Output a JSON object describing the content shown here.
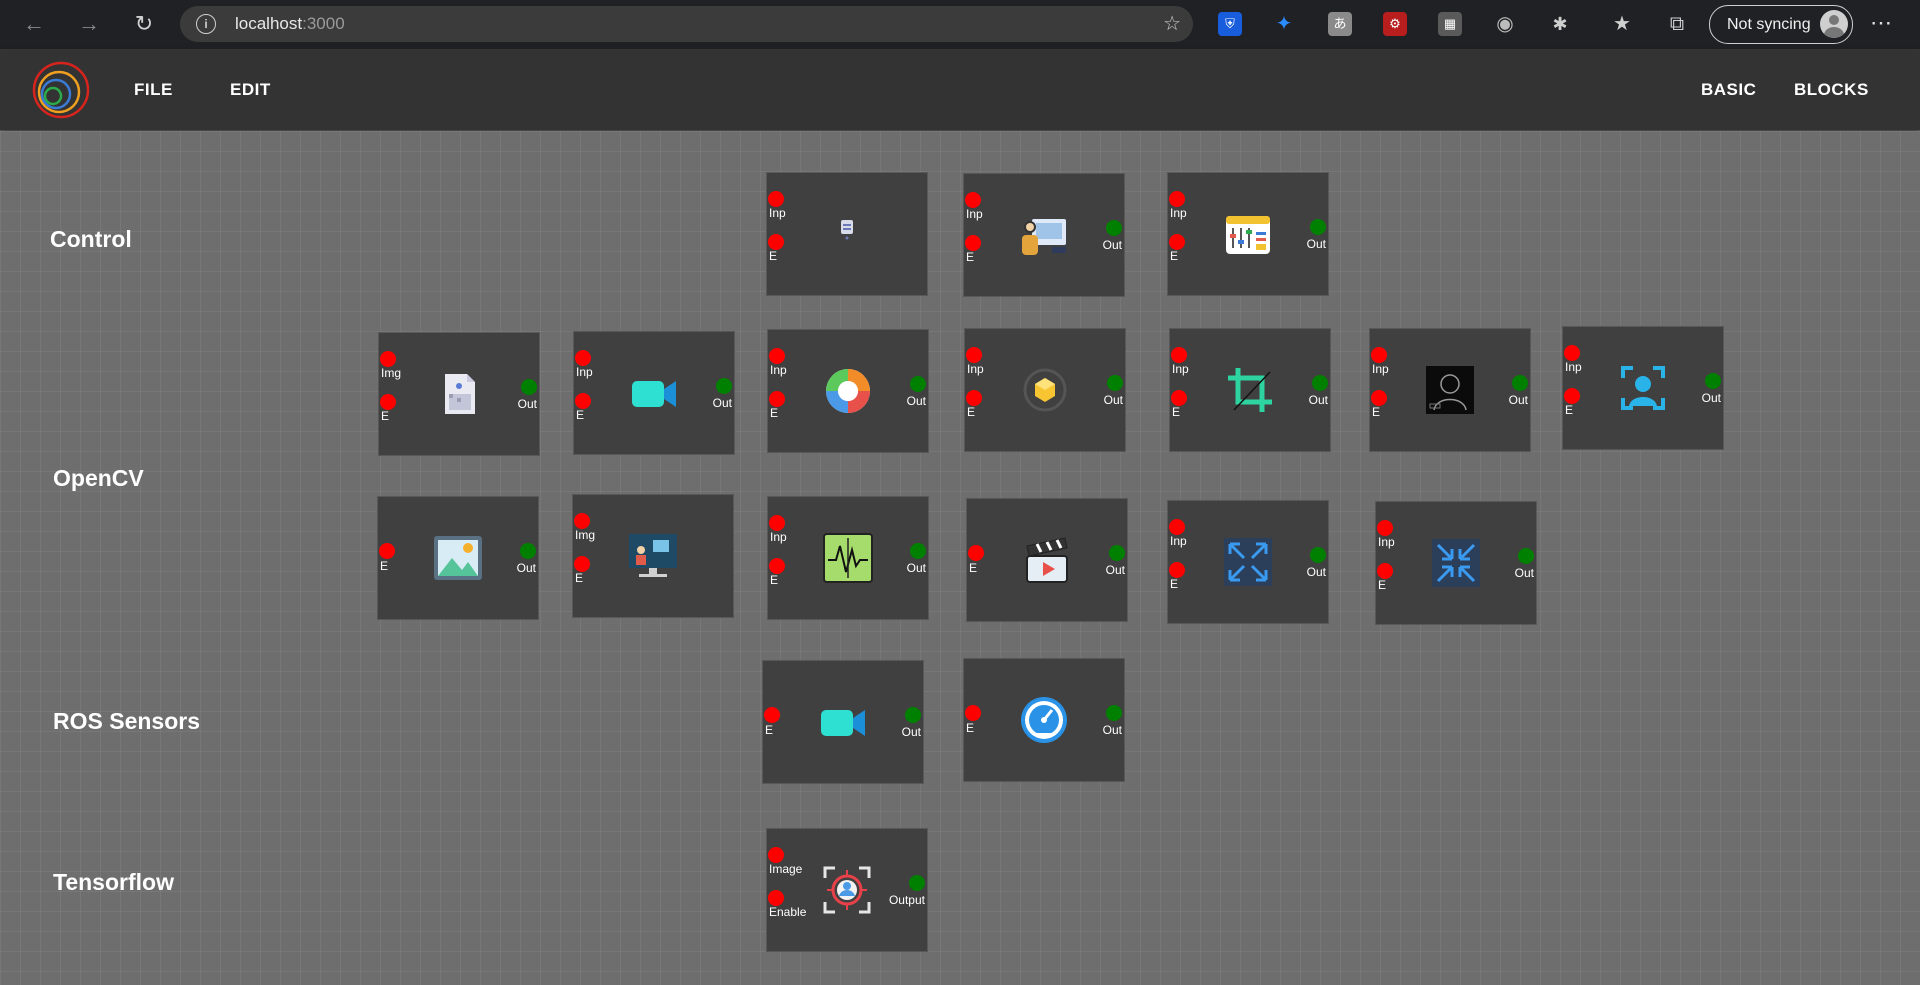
{
  "browser": {
    "url_host": "localhost",
    "url_port": ":3000",
    "sync_label": "Not syncing"
  },
  "app_header": {
    "menu_left": [
      "FILE",
      "EDIT"
    ],
    "menu_right": [
      "BASIC",
      "BLOCKS"
    ]
  },
  "sections": [
    "Control",
    "OpenCV",
    "ROS Sensors",
    "Tensorflow"
  ],
  "colors": {
    "input_port": "#ff0000",
    "output_port": "#008000",
    "block_bg": "#404040",
    "canvas_bg": "#6e6e6e",
    "header_bg": "#333333"
  },
  "blocks": [
    {
      "section": "Control",
      "icon": "usb-drive-icon",
      "inputs": [
        "Inp",
        "E"
      ],
      "outputs": []
    },
    {
      "section": "Control",
      "icon": "presenter-screen-icon",
      "inputs": [
        "Inp",
        "E"
      ],
      "outputs": [
        "Out"
      ]
    },
    {
      "section": "Control",
      "icon": "sliders-panel-icon",
      "inputs": [
        "Inp",
        "E"
      ],
      "outputs": [
        "Out"
      ]
    },
    {
      "section": "OpenCV",
      "icon": "image-file-icon",
      "inputs": [
        "Img",
        "E"
      ],
      "outputs": [
        "Out"
      ]
    },
    {
      "section": "OpenCV",
      "icon": "video-camera-icon",
      "inputs": [
        "Inp",
        "E"
      ],
      "outputs": [
        "Out"
      ]
    },
    {
      "section": "OpenCV",
      "icon": "color-wheel-icon",
      "inputs": [
        "Inp",
        "E"
      ],
      "outputs": [
        "Out"
      ]
    },
    {
      "section": "OpenCV",
      "icon": "hexagon-target-icon",
      "inputs": [
        "Inp",
        "E"
      ],
      "outputs": [
        "Out"
      ]
    },
    {
      "section": "OpenCV",
      "icon": "crop-icon",
      "inputs": [
        "Inp",
        "E"
      ],
      "outputs": [
        "Out"
      ]
    },
    {
      "section": "OpenCV",
      "icon": "face-silhouette-icon",
      "inputs": [
        "Inp",
        "E"
      ],
      "outputs": [
        "Out"
      ]
    },
    {
      "section": "OpenCV",
      "icon": "face-scan-icon",
      "inputs": [
        "Inp",
        "E"
      ],
      "outputs": [
        "Out"
      ]
    },
    {
      "section": "OpenCV",
      "icon": "landscape-image-icon",
      "inputs": [
        "E"
      ],
      "outputs": [
        "Out"
      ]
    },
    {
      "section": "OpenCV",
      "icon": "monitor-display-icon",
      "inputs": [
        "Img",
        "E"
      ],
      "outputs": []
    },
    {
      "section": "OpenCV",
      "icon": "waveform-chart-icon",
      "inputs": [
        "Inp",
        "E"
      ],
      "outputs": [
        "Out"
      ]
    },
    {
      "section": "OpenCV",
      "icon": "clapperboard-icon",
      "inputs": [
        "E"
      ],
      "outputs": [
        "Out"
      ]
    },
    {
      "section": "OpenCV",
      "icon": "expand-arrows-icon",
      "inputs": [
        "Inp",
        "E"
      ],
      "outputs": [
        "Out"
      ]
    },
    {
      "section": "OpenCV",
      "icon": "collapse-arrows-icon",
      "inputs": [
        "Inp",
        "E"
      ],
      "outputs": [
        "Out"
      ]
    },
    {
      "section": "ROS Sensors",
      "icon": "video-camera-icon",
      "inputs": [
        "E"
      ],
      "outputs": [
        "Out"
      ]
    },
    {
      "section": "ROS Sensors",
      "icon": "speedometer-icon",
      "inputs": [
        "E"
      ],
      "outputs": [
        "Out"
      ]
    },
    {
      "section": "Tensorflow",
      "icon": "object-detect-icon",
      "inputs": [
        "Image",
        "Enable"
      ],
      "outputs": [
        "Output"
      ]
    }
  ]
}
